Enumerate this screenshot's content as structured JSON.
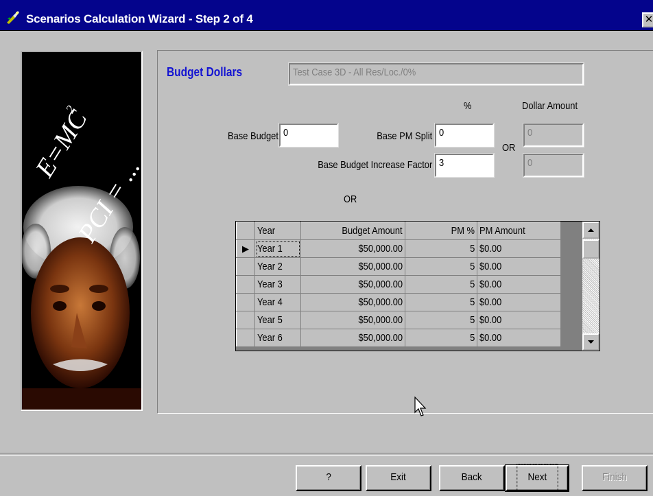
{
  "window": {
    "title": "Scenarios Calculation Wizard - Step 2 of 4",
    "close_glyph": "✕"
  },
  "image": {
    "formula1": "E=MC",
    "formula1_sup": "2",
    "formula2": "PCI = ..."
  },
  "section": {
    "title": "Budget Dollars",
    "scenario_name": "Test Case 3D - All Res/Loc./0%"
  },
  "headers": {
    "percent": "%",
    "dollar_amount": "Dollar Amount"
  },
  "fields": {
    "base_budget_label": "Base Budget",
    "base_budget_value": "0",
    "base_pm_split_label": "Base PM Split",
    "base_pm_split_value": "0",
    "pm_dollar_value": "0",
    "increase_factor_label": "Base Budget Increase Factor",
    "increase_factor_value": "3",
    "increase_dollar_value": "0",
    "or_label_side": "OR",
    "or_label_center": "OR"
  },
  "grid": {
    "columns": [
      "Year",
      "Budget Amount",
      "PM %",
      "PM Amount"
    ],
    "rows": [
      {
        "year": "Year 1",
        "budget": "$50,000.00",
        "pm_pct": "5",
        "pm_amount": "$0.00"
      },
      {
        "year": "Year 2",
        "budget": "$50,000.00",
        "pm_pct": "5",
        "pm_amount": "$0.00"
      },
      {
        "year": "Year 3",
        "budget": "$50,000.00",
        "pm_pct": "5",
        "pm_amount": "$0.00"
      },
      {
        "year": "Year 4",
        "budget": "$50,000.00",
        "pm_pct": "5",
        "pm_amount": "$0.00"
      },
      {
        "year": "Year 5",
        "budget": "$50,000.00",
        "pm_pct": "5",
        "pm_amount": "$0.00"
      },
      {
        "year": "Year 6",
        "budget": "$50,000.00",
        "pm_pct": "5",
        "pm_amount": "$0.00"
      }
    ],
    "current_row_glyph": "▶"
  },
  "buttons": {
    "help": "?",
    "exit": "Exit",
    "back": "Back",
    "next": "Next",
    "finish": "Finish"
  },
  "colors": {
    "title_bar": "#04048c",
    "section_title": "#1414d2",
    "dialog": "#c0c0c0"
  }
}
